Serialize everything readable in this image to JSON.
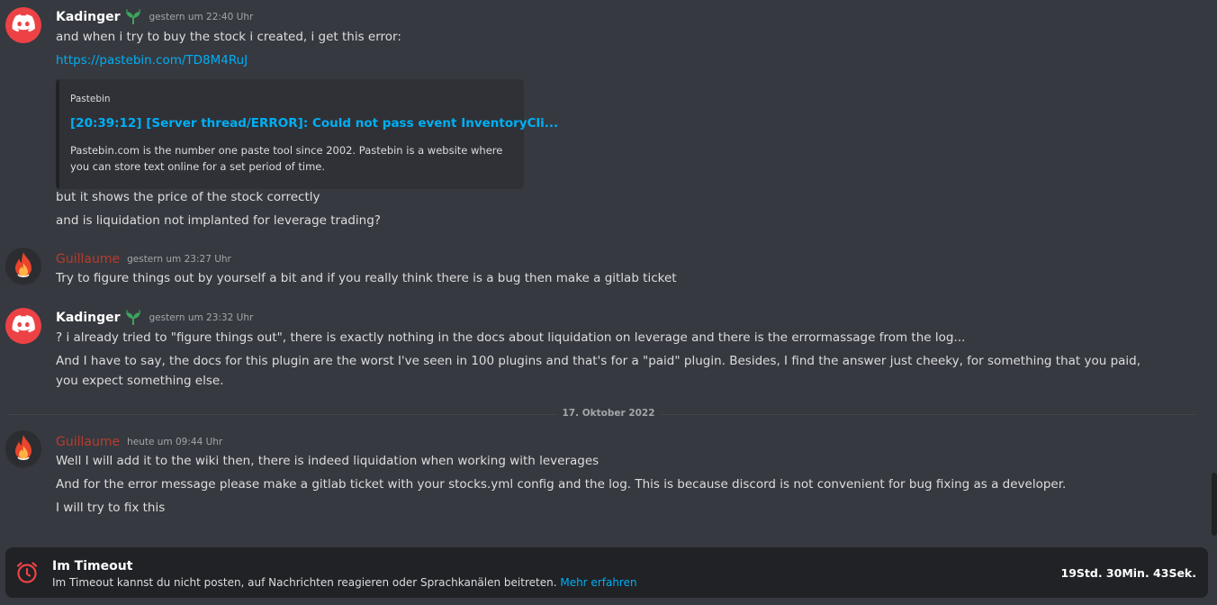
{
  "messages": [
    {
      "author": "Kadinger",
      "timestamp": "gestern um 22:40 Uhr",
      "lines": [
        "and when i try to buy the stock i created, i get this error:",
        "https://pastebin.com/TD8M4RuJ",
        "but it shows the price of the stock correctly",
        "and is liquidation not implanted for leverage trading?"
      ],
      "embed": {
        "provider": "Pastebin",
        "title": "[20:39:12] [Server thread/ERROR]: Could not pass event InventoryCli...",
        "description": "Pastebin.com is the number one paste tool since 2002. Pastebin is a website where you can store text online for a set period of time."
      }
    },
    {
      "author": "Guillaume",
      "timestamp": "gestern um 23:27 Uhr",
      "lines": [
        "Try to figure things out by yourself a bit and if you really think there is a bug then make a gitlab ticket"
      ]
    },
    {
      "author": "Kadinger",
      "timestamp": "gestern um 23:32 Uhr",
      "lines": [
        "? i already tried to \"figure things out\", there is exactly nothing in the docs about liquidation on leverage and there is the errormassage from the log...",
        "And I have to say, the docs for this plugin are the worst I've seen in 100 plugins and that's for a \"paid\" plugin. Besides, I find the answer just cheeky, for something that you paid, you expect something else."
      ]
    },
    {
      "author": "Guillaume",
      "timestamp": "heute um 09:44 Uhr",
      "lines": [
        "Well I will add it to the wiki then, there is indeed liquidation when working with leverages",
        "And for the error message please make a gitlab ticket with your stocks.yml config and the log. This is because discord is not convenient for bug fixing as a developer.",
        "I will try to fix this"
      ]
    }
  ],
  "date_divider": "17. Oktober 2022",
  "timeout": {
    "title": "Im Timeout",
    "description": "Im Timeout kannst du nicht posten, auf Nachrichten reagieren oder Sprachkanälen beitreten.",
    "learn_more": "Mehr erfahren",
    "timer": "19Std. 30Min. 43Sek."
  },
  "colors": {
    "background": "#36393f",
    "link": "#00aff4",
    "discord_avatar": "#ed4245",
    "guillaume_name": "#b73c2e",
    "badge_green": "#3ba55c"
  }
}
